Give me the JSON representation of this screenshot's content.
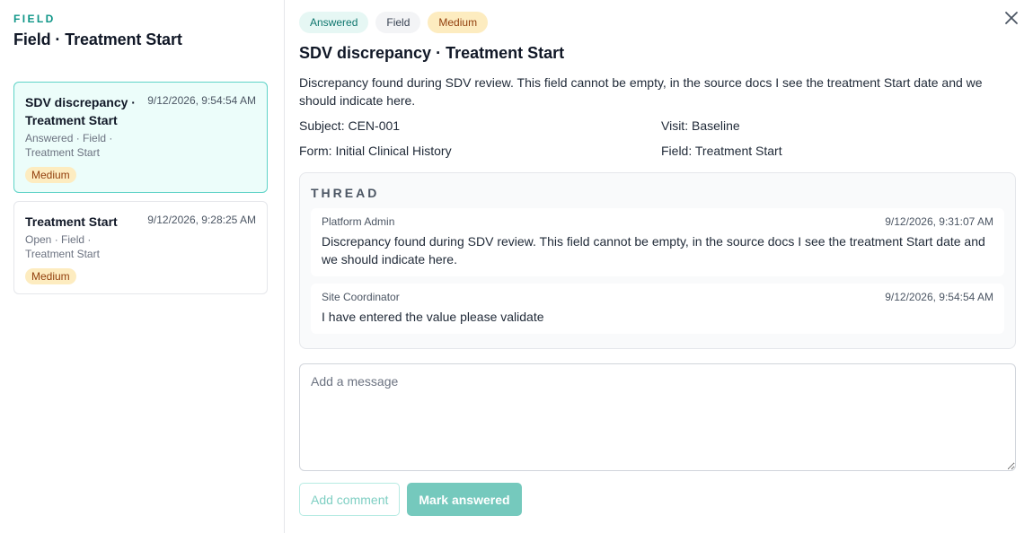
{
  "sidebar": {
    "kicker": "FIELD",
    "title": "Field · Treatment Start",
    "queries": [
      {
        "title": "SDV discrepancy · Treatment Start",
        "time": "9/12/2026, 9:54:54 AM",
        "meta": "Answered · Field · Treatment Start",
        "priority": "Medium"
      },
      {
        "title": "Treatment Start",
        "time": "9/12/2026, 9:28:25 AM",
        "meta": "Open · Field · Treatment Start",
        "priority": "Medium"
      }
    ]
  },
  "detail": {
    "chips": {
      "status": "Answered",
      "type": "Field",
      "priority": "Medium"
    },
    "title": "SDV discrepancy · Treatment Start",
    "description": "Discrepancy found during SDV review. This field cannot be empty, in the source docs I see the treatment Start date and we should indicate here.",
    "facts": {
      "subject": "Subject: CEN-001",
      "visit": "Visit: Baseline",
      "form": "Form: Initial Clinical History",
      "field": "Field: Treatment Start"
    },
    "thread": {
      "title": "THREAD",
      "messages": [
        {
          "author": "Platform Admin",
          "time": "9/12/2026, 9:31:07 AM",
          "body": "Discrepancy found during SDV review. This field cannot be empty, in the source docs I see the treatment Start date and we should indicate here."
        },
        {
          "author": "Site Coordinator",
          "time": "9/12/2026, 9:54:54 AM",
          "body": "I have entered the value please validate"
        }
      ]
    },
    "composer": {
      "placeholder": "Add a message",
      "value": ""
    },
    "actions": {
      "add_comment": "Add comment",
      "mark_answered": "Mark answered"
    }
  },
  "icons": {
    "close": "close-icon"
  },
  "colors": {
    "accent": "#0f9688",
    "active_card_bg": "#ecfdfa",
    "active_card_border": "#5fd3c7",
    "medium_badge_bg": "#fdecc0",
    "medium_badge_fg": "#92400e",
    "primary_button": "#75c9bd"
  }
}
